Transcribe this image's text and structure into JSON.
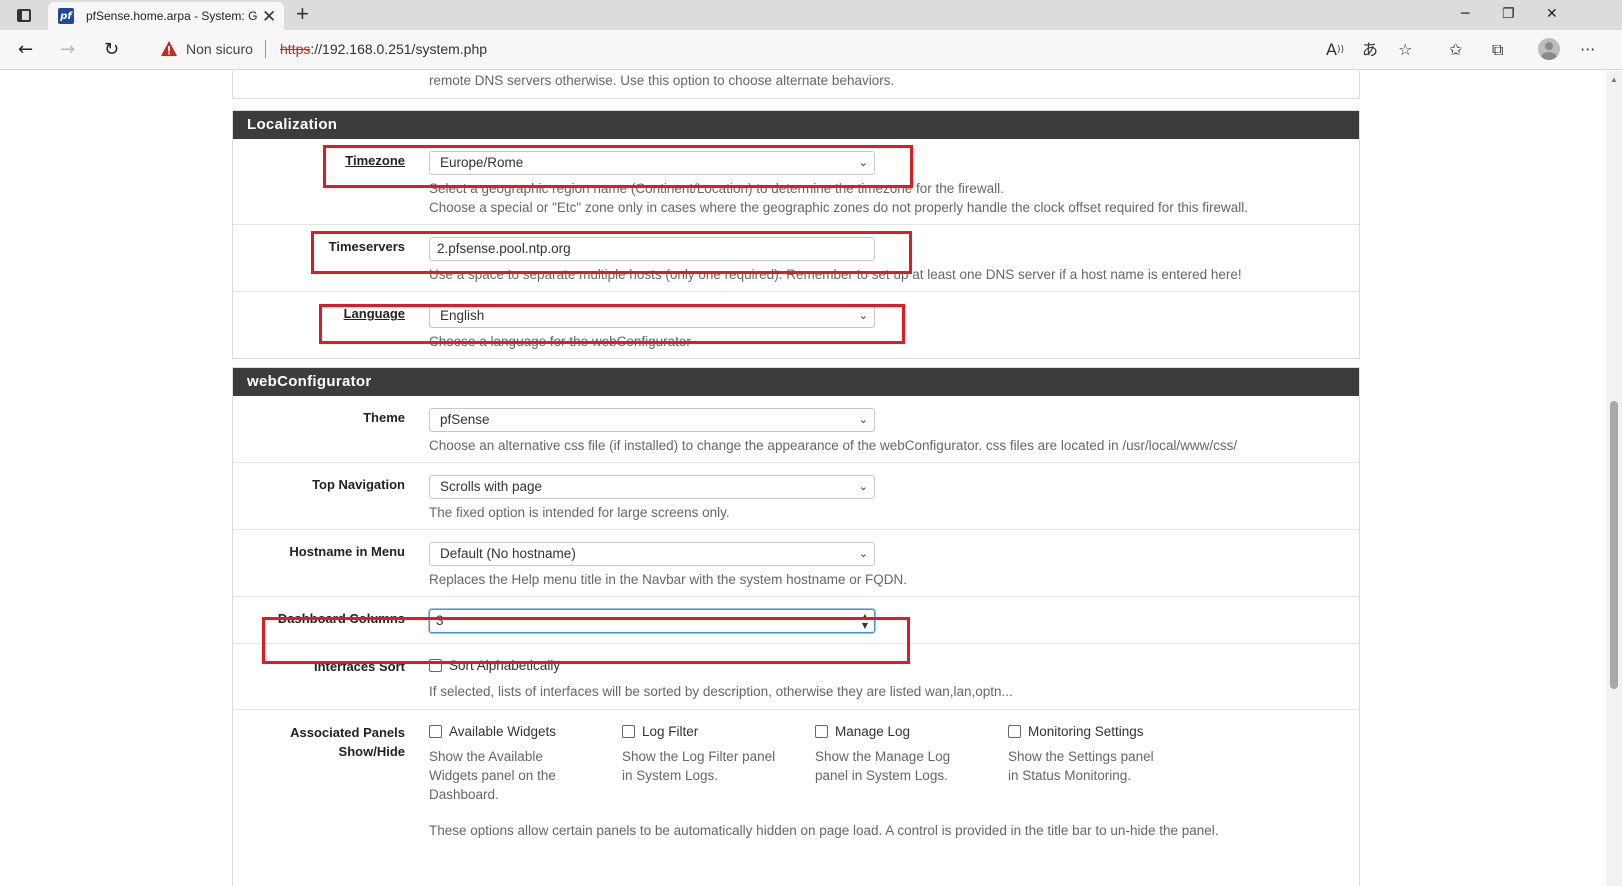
{
  "browser": {
    "tab_title": "pfSense.home.arpa - System: General Setup",
    "favicon_text": "pf",
    "security_label": "Non sicuro",
    "url_scheme": "https",
    "url_rest": "://192.168.0.251/system.php"
  },
  "top_fragment": "remote DNS servers otherwise. Use this option to choose alternate behaviors.",
  "localization": {
    "heading": "Localization",
    "timezone": {
      "label": "Timezone",
      "value": "Europe/Rome",
      "help1": "Select a geographic region name (Continent/Location) to determine the timezone for the firewall.",
      "help2": "Choose a special or \"Etc\" zone only in cases where the geographic zones do not properly handle the clock offset required for this firewall."
    },
    "timeservers": {
      "label": "Timeservers",
      "value": "2.pfsense.pool.ntp.org",
      "help": "Use a space to separate multiple hosts (only one required). Remember to set up at least one DNS server if a host name is entered here!"
    },
    "language": {
      "label": "Language",
      "value": "English",
      "help": "Choose a language for the webConfigurator"
    }
  },
  "webconfigurator": {
    "heading": "webConfigurator",
    "theme": {
      "label": "Theme",
      "value": "pfSense",
      "help": "Choose an alternative css file (if installed) to change the appearance of the webConfigurator. css files are located in /usr/local/www/css/"
    },
    "top_navigation": {
      "label": "Top Navigation",
      "value": "Scrolls with page",
      "help": "The fixed option is intended for large screens only."
    },
    "hostname_menu": {
      "label": "Hostname in Menu",
      "value": "Default (No hostname)",
      "help": "Replaces the Help menu title in the Navbar with the system hostname or FQDN."
    },
    "dashboard_columns": {
      "label": "Dashboard Columns",
      "value": "3"
    },
    "interfaces_sort": {
      "label": "Interfaces Sort",
      "checkbox_label": "Sort Alphabetically",
      "help": "If selected, lists of interfaces will be sorted by description, otherwise they are listed wan,lan,optn..."
    },
    "associated_panels": {
      "label_line1": "Associated Panels",
      "label_line2": "Show/Hide",
      "items": [
        {
          "label": "Available Widgets",
          "help1": "Show the Available",
          "help2": "Widgets panel on the",
          "help3": "Dashboard."
        },
        {
          "label": "Log Filter",
          "help1": "Show the Log Filter panel",
          "help2": "in System Logs."
        },
        {
          "label": "Manage Log",
          "help1": "Show the Manage Log",
          "help2": "panel in System Logs."
        },
        {
          "label": "Monitoring Settings",
          "help1": "Show the Settings panel",
          "help2": "in Status Monitoring."
        }
      ],
      "help": "These options allow certain panels to be automatically hidden on page load. A control is provided in the title bar to un-hide the panel."
    }
  },
  "highlight_color": "#e11b22"
}
